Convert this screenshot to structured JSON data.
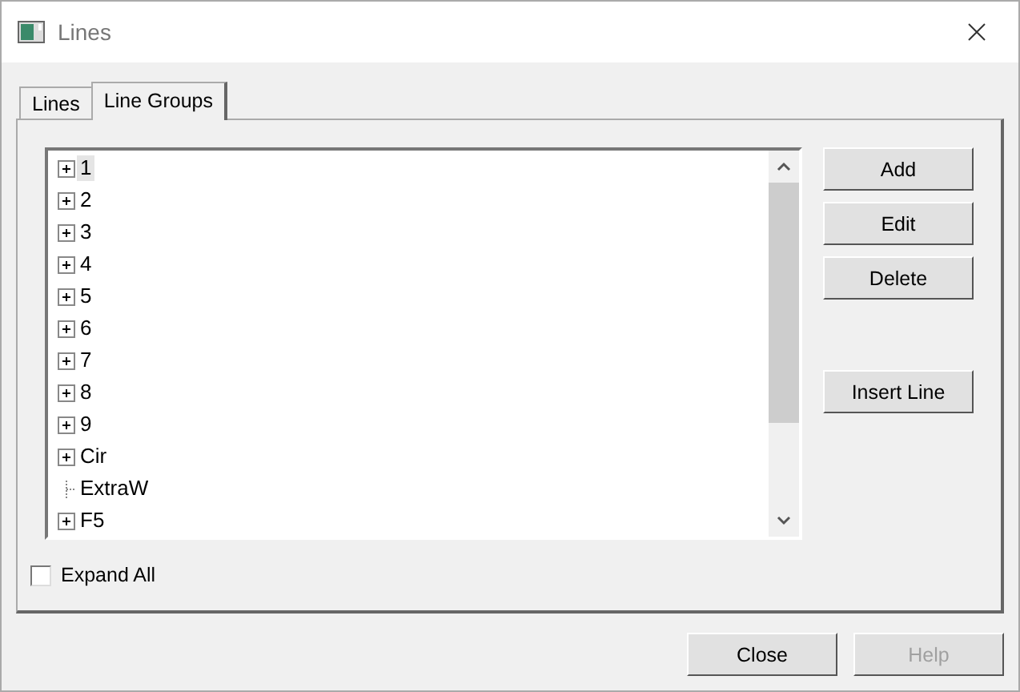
{
  "window": {
    "title": "Lines"
  },
  "tabs": [
    {
      "label": "Lines",
      "selected": false
    },
    {
      "label": "Line Groups",
      "selected": true
    }
  ],
  "tree": {
    "items": [
      {
        "label": "1",
        "kind": "group",
        "selected": true
      },
      {
        "label": "2",
        "kind": "group",
        "selected": false
      },
      {
        "label": "3",
        "kind": "group",
        "selected": false
      },
      {
        "label": "4",
        "kind": "group",
        "selected": false
      },
      {
        "label": "5",
        "kind": "group",
        "selected": false
      },
      {
        "label": "6",
        "kind": "group",
        "selected": false
      },
      {
        "label": "7",
        "kind": "group",
        "selected": false
      },
      {
        "label": "8",
        "kind": "group",
        "selected": false
      },
      {
        "label": "9",
        "kind": "group",
        "selected": false
      },
      {
        "label": "Cir",
        "kind": "group",
        "selected": false
      },
      {
        "label": "ExtraW",
        "kind": "leaf",
        "selected": false
      },
      {
        "label": "F5",
        "kind": "group",
        "selected": false
      }
    ]
  },
  "side_buttons": [
    {
      "label": "Add"
    },
    {
      "label": "Edit"
    },
    {
      "label": "Delete"
    }
  ],
  "insert_button": {
    "label": "Insert Line"
  },
  "expand_all": {
    "label": "Expand All",
    "checked": false
  },
  "buttons": [
    {
      "label": "Close",
      "disabled": false
    },
    {
      "label": "Help",
      "disabled": true
    }
  ]
}
